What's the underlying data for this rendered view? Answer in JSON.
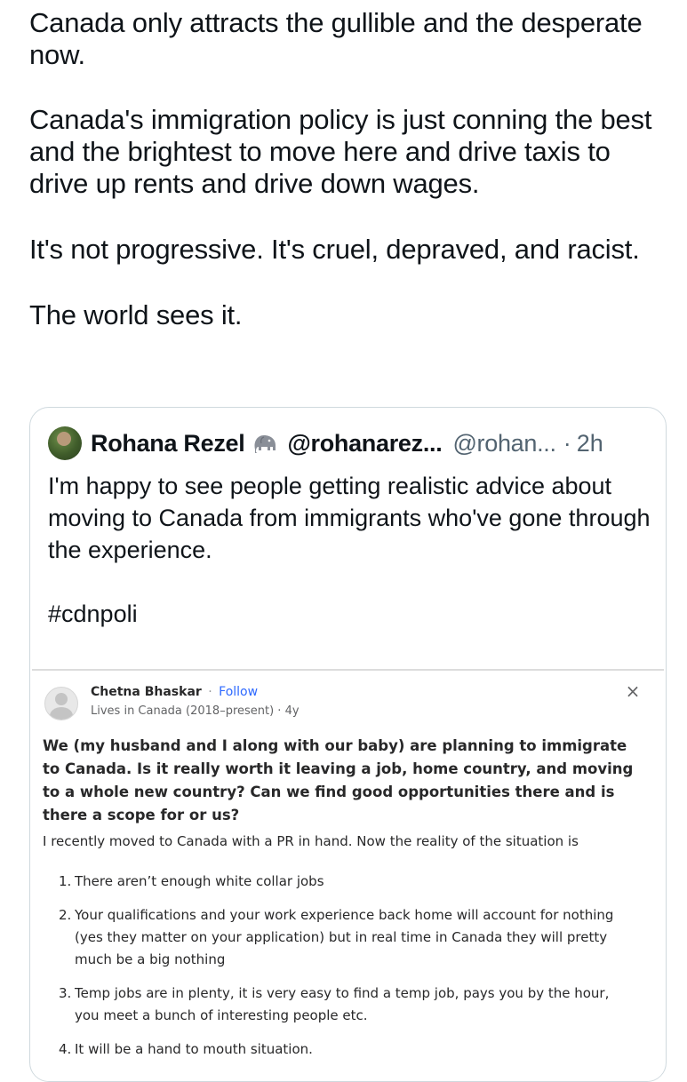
{
  "tweet": {
    "paragraphs": [
      "Canada only attracts the gullible and the desperate now.",
      "Canada's immigration policy is just conning the best and the brightest to move here and drive taxis to drive up rents and drive down wages.",
      "It's not progressive. It's cruel, depraved, and racist.",
      "The world sees it."
    ]
  },
  "quote": {
    "name": "Rohana Rezel",
    "name_icon": "elephant-icon",
    "handle_bold": "@rohanarez...",
    "handle": "@rohan...",
    "separator": "·",
    "time": "2h",
    "text": "I'm happy to see people getting realistic advice about moving to Canada from immigrants who've gone through the experience.",
    "hashtag": "#cdnpoli",
    "border_color": "#cfd9de"
  },
  "embedded_post": {
    "author": "Chetna Bhaskar",
    "separator": "·",
    "follow_label": "Follow",
    "meta": "Lives in Canada (2018–present) · 4y",
    "close_icon": "close-icon",
    "close_glyph": "×",
    "question": "We (my husband and I along with our baby) are planning to immigrate to Canada. Is it really worth it leaving a job, home country, and moving to a whole new country? Can we find good opportunities there and is there a scope for or us?",
    "intro": "I recently moved to Canada with a PR in hand. Now the reality of the situation is",
    "list": [
      {
        "num": "1.",
        "text": "There aren’t enough white collar jobs"
      },
      {
        "num": "2.",
        "text": "Your qualifications and your work experience back home will account for nothing (yes they matter on your application) but in real time in Canada they will pretty much be a big nothing"
      },
      {
        "num": "3.",
        "text": "Temp jobs are in plenty, it is very easy to find a temp job, pays you by the hour, you meet a bunch of interesting people etc."
      },
      {
        "num": "4.",
        "text": "It will be a hand to mouth situation."
      }
    ],
    "follow_color": "#2e69ff"
  }
}
